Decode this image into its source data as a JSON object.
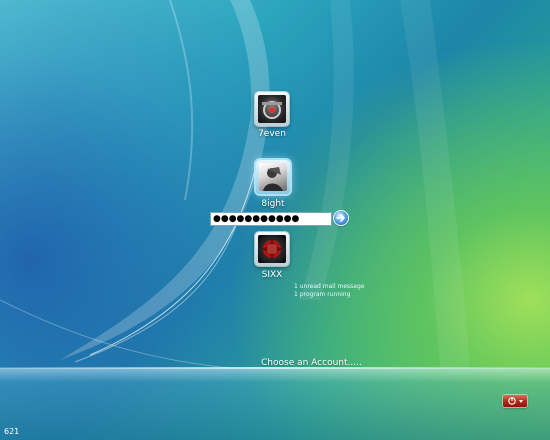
{
  "accounts": [
    {
      "name": "7even",
      "picture": "gear-car-avatar-icon"
    },
    {
      "name": "8ight",
      "picture": "portrait-avatar-icon"
    },
    {
      "name": "SIXX",
      "picture": "red-emblem-avatar-icon"
    }
  ],
  "password": {
    "value": "●●●●●●●●●●●",
    "masked": true
  },
  "go_icon": "arrow-right-icon",
  "status_lines": [
    "1 unread mail message",
    "1 program running"
  ],
  "prompt": "Choose an Account.....",
  "shutdown_icon": "power-icon",
  "build_label": "621",
  "colors": {
    "sky": "#2aa3bd",
    "green": "#5cc964",
    "shutdown": "#b52418",
    "go": "#1c5fb8"
  }
}
